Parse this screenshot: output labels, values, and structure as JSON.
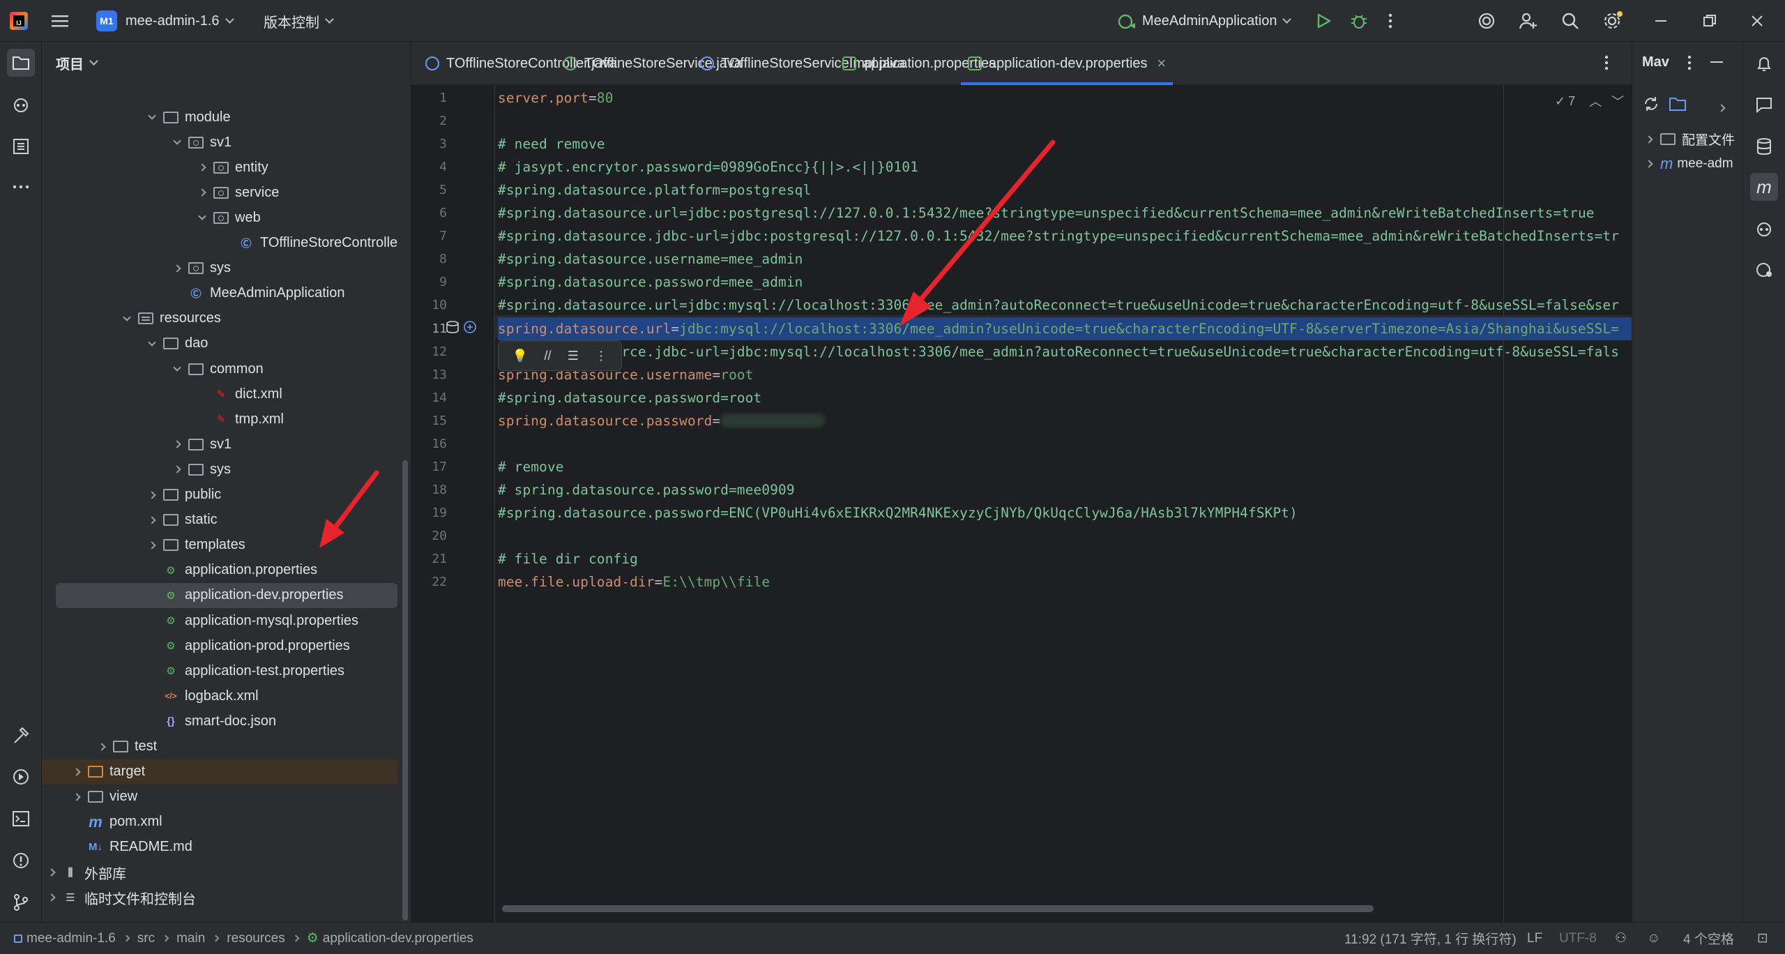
{
  "titlebar": {
    "project_badge": "M1",
    "project_name": "mee-admin-1.6",
    "vcs_label": "版本控制",
    "run_config": "MeeAdminApplication"
  },
  "project_panel": {
    "title": "项目",
    "tree": [
      {
        "label": "module",
        "indent": 2,
        "arrow": "down",
        "icon": "folder"
      },
      {
        "label": "sv1",
        "indent": 3,
        "arrow": "down",
        "icon": "package"
      },
      {
        "label": "entity",
        "indent": 4,
        "arrow": "right",
        "icon": "package"
      },
      {
        "label": "service",
        "indent": 4,
        "arrow": "right",
        "icon": "package"
      },
      {
        "label": "web",
        "indent": 4,
        "arrow": "down",
        "icon": "package"
      },
      {
        "label": "TOfflineStoreControlle",
        "indent": 5,
        "arrow": "",
        "icon": "class"
      },
      {
        "label": "sys",
        "indent": 3,
        "arrow": "right",
        "icon": "package"
      },
      {
        "label": "MeeAdminApplication",
        "indent": 3,
        "arrow": "",
        "icon": "spring-class"
      },
      {
        "label": "resources",
        "indent": 1,
        "arrow": "down",
        "icon": "resources"
      },
      {
        "label": "dao",
        "indent": 2,
        "arrow": "down",
        "icon": "folder"
      },
      {
        "label": "common",
        "indent": 3,
        "arrow": "down",
        "icon": "folder"
      },
      {
        "label": "dict.xml",
        "indent": 4,
        "arrow": "",
        "icon": "mybatis"
      },
      {
        "label": "tmp.xml",
        "indent": 4,
        "arrow": "",
        "icon": "mybatis"
      },
      {
        "label": "sv1",
        "indent": 3,
        "arrow": "right",
        "icon": "folder"
      },
      {
        "label": "sys",
        "indent": 3,
        "arrow": "right",
        "icon": "folder"
      },
      {
        "label": "public",
        "indent": 2,
        "arrow": "right",
        "icon": "folder"
      },
      {
        "label": "static",
        "indent": 2,
        "arrow": "right",
        "icon": "folder"
      },
      {
        "label": "templates",
        "indent": 2,
        "arrow": "right",
        "icon": "folder"
      },
      {
        "label": "application.properties",
        "indent": 2,
        "arrow": "",
        "icon": "properties"
      },
      {
        "label": "application-dev.properties",
        "indent": 2,
        "arrow": "",
        "icon": "properties",
        "selected": true
      },
      {
        "label": "application-mysql.properties",
        "indent": 2,
        "arrow": "",
        "icon": "properties"
      },
      {
        "label": "application-prod.properties",
        "indent": 2,
        "arrow": "",
        "icon": "properties"
      },
      {
        "label": "application-test.properties",
        "indent": 2,
        "arrow": "",
        "icon": "properties"
      },
      {
        "label": "logback.xml",
        "indent": 2,
        "arrow": "",
        "icon": "xml"
      },
      {
        "label": "smart-doc.json",
        "indent": 2,
        "arrow": "",
        "icon": "json"
      },
      {
        "label": "test",
        "indent": 0,
        "arrow": "right",
        "icon": "folder"
      },
      {
        "label": "target",
        "indent": -1,
        "arrow": "right",
        "icon": "folder-orange",
        "target": true
      },
      {
        "label": "view",
        "indent": -1,
        "arrow": "right",
        "icon": "folder"
      },
      {
        "label": "pom.xml",
        "indent": -1,
        "arrow": "",
        "icon": "maven"
      },
      {
        "label": "README.md",
        "indent": -1,
        "arrow": "",
        "icon": "markdown"
      },
      {
        "label": "外部库",
        "indent": -2,
        "arrow": "right",
        "icon": "library"
      },
      {
        "label": "临时文件和控制台",
        "indent": -2,
        "arrow": "right",
        "icon": "scratch"
      }
    ]
  },
  "tabs": [
    {
      "label": "TOfflineStoreController.java",
      "icon": "class"
    },
    {
      "label": "TOfflineStoreService.java",
      "icon": "interface"
    },
    {
      "label": "TOfflineStoreServiceImpl.java",
      "icon": "class"
    },
    {
      "label": "application.properties",
      "icon": "properties"
    },
    {
      "label": "application-dev.properties",
      "icon": "properties",
      "active": true
    }
  ],
  "editor": {
    "inspection_count": "7",
    "lines": [
      {
        "n": "1",
        "type": "kv",
        "key": "server.port",
        "val": "80"
      },
      {
        "n": "2",
        "type": "empty",
        "text": ""
      },
      {
        "n": "3",
        "type": "comment",
        "text": "# need remove"
      },
      {
        "n": "4",
        "type": "comment",
        "text": "# jasypt.encrytor.password=0989GoEncc}{||>.<||}0101"
      },
      {
        "n": "5",
        "type": "comment",
        "text": "#spring.datasource.platform=postgresql"
      },
      {
        "n": "6",
        "type": "comment",
        "text": "#spring.datasource.url=jdbc:postgresql://127.0.0.1:5432/mee?stringtype=unspecified&currentSchema=mee_admin&reWriteBatchedInserts=true"
      },
      {
        "n": "7",
        "type": "comment",
        "text": "#spring.datasource.jdbc-url=jdbc:postgresql://127.0.0.1:5432/mee?stringtype=unspecified&currentSchema=mee_admin&reWriteBatchedInserts=tr"
      },
      {
        "n": "8",
        "type": "comment",
        "text": "#spring.datasource.username=mee_admin"
      },
      {
        "n": "9",
        "type": "comment",
        "text": "#spring.datasource.password=mee_admin"
      },
      {
        "n": "10",
        "type": "comment",
        "text": "#spring.datasource.url=jdbc:mysql://localhost:3306/mee_admin?autoReconnect=true&useUnicode=true&characterEncoding=utf-8&useSSL=false&ser"
      },
      {
        "n": "11",
        "type": "kv",
        "key": "spring.datasource.url",
        "val": "jdbc:mysql://localhost:3306/mee_admin?useUnicode=true&characterEncoding=UTF-8&serverTimezone=Asia/Shanghai&useSSL=",
        "selected": true
      },
      {
        "n": "12",
        "type": "comment",
        "text": "#spring.datasource.jdbc-url=jdbc:mysql://localhost:3306/mee_admin?autoReconnect=true&useUnicode=true&characterEncoding=utf-8&useSSL=fals"
      },
      {
        "n": "13",
        "type": "kv",
        "key": "spring.datasource.username",
        "val": "root"
      },
      {
        "n": "14",
        "type": "comment",
        "text": "#spring.datasource.password=root"
      },
      {
        "n": "15",
        "type": "kv-blur",
        "key": "spring.datasource.password",
        "val": ""
      },
      {
        "n": "16",
        "type": "empty",
        "text": ""
      },
      {
        "n": "17",
        "type": "comment",
        "text": "# remove"
      },
      {
        "n": "18",
        "type": "comment",
        "text": "# spring.datasource.password=mee0909"
      },
      {
        "n": "19",
        "type": "comment",
        "text": "#spring.datasource.password=ENC(VP0uHi4v6xEIKRxQ2MR4NKExyzyCjNYb/QkUqcClywJ6a/HAsb3l7kYMPH4fSKPt)"
      },
      {
        "n": "20",
        "type": "empty",
        "text": ""
      },
      {
        "n": "21",
        "type": "comment",
        "text": "# file dir config"
      },
      {
        "n": "22",
        "type": "kv",
        "key": "mee.file.upload-dir",
        "val": "E:\\\\tmp\\\\file"
      }
    ]
  },
  "maven_panel": {
    "title": "Mav",
    "items": [
      {
        "label": "配置文件"
      },
      {
        "label": "mee-adm"
      }
    ]
  },
  "statusbar": {
    "crumbs": [
      "mee-admin-1.6",
      "src",
      "main",
      "resources",
      "application-dev.properties"
    ],
    "position": "11:92 (171 字符, 1 行 换行符)",
    "line_sep": "LF",
    "encoding": "UTF-8",
    "indent": "4 个空格"
  },
  "colors": {
    "accent": "#3574f0",
    "annotation_arrow": "#e5242b",
    "comment": "#7ec699",
    "key": "#cf8e6d",
    "value": "#6aab73"
  }
}
